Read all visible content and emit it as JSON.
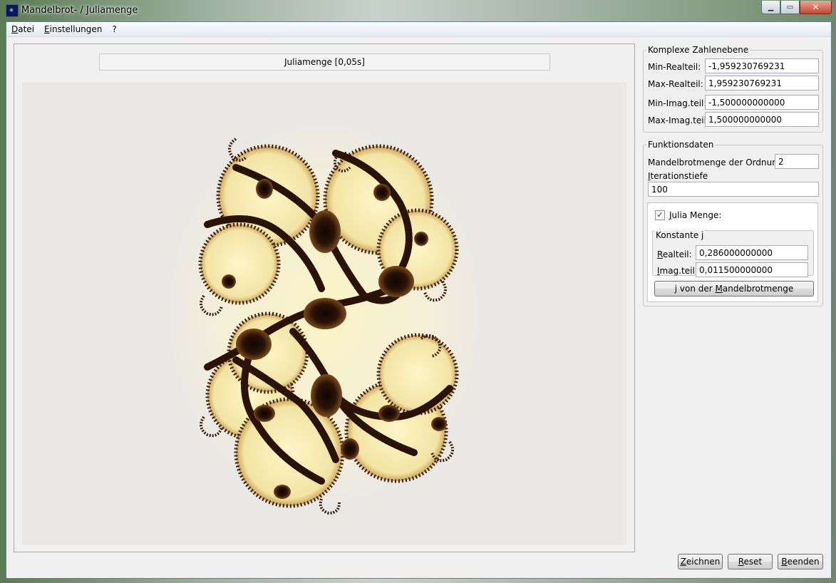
{
  "window": {
    "title": "Mandelbrot- / Juliamenge"
  },
  "menu": [
    {
      "label": "Datei",
      "mnemonic": "D",
      "rest": "atei"
    },
    {
      "label": "Einstellungen",
      "mnemonic": "E",
      "rest": "instellungen"
    },
    {
      "label": "?",
      "mnemonic": "",
      "rest": "?"
    }
  ],
  "canvas": {
    "status": "Juliamenge [0,05s]"
  },
  "complex_plane": {
    "legend": "Komplexe Zahlenebene",
    "min_real_label": "Min-Realteil:",
    "min_real_value": "-1,959230769231",
    "max_real_label": "Max-Realteil:",
    "max_real_value": "1,959230769231",
    "min_imag_label": "Min-Imag.teil:",
    "min_imag_value": "-1,500000000000",
    "max_imag_label": "Max-Imag.teil",
    "max_imag_value": "1,500000000000"
  },
  "function_data": {
    "legend": "Funktionsdaten",
    "order_label": "Mandelbrotmenge der Ordnung:",
    "order_value": "2",
    "iter_label_u": "I",
    "iter_label_rest": "terationstiefe",
    "iter_value": "100",
    "julia_checkbox_label_u": "J",
    "julia_checkbox_label_rest": "ulia Menge:",
    "julia_checked": true,
    "constant": {
      "legend": "Konstante j",
      "real_label_u": "R",
      "real_label_rest": "ealteil:",
      "real_value": "0,286000000000",
      "imag_label_u": "I",
      "imag_label_rest": "mag.teil:",
      "imag_value": "0,011500000000"
    },
    "from_mandelbrot_button": {
      "pre": "j von der ",
      "u": "M",
      "rest": "andelbrotmenge"
    }
  },
  "bottom_buttons": [
    {
      "u": "Z",
      "rest": "eichnen"
    },
    {
      "u": "R",
      "rest": "eset"
    },
    {
      "u": "B",
      "rest": "eenden"
    }
  ],
  "colors": {
    "fractal_dark": "#1b0c05",
    "fractal_mid": "#6b3d16",
    "fractal_light": "#fdf6c9",
    "background": "#e9e8e5"
  }
}
